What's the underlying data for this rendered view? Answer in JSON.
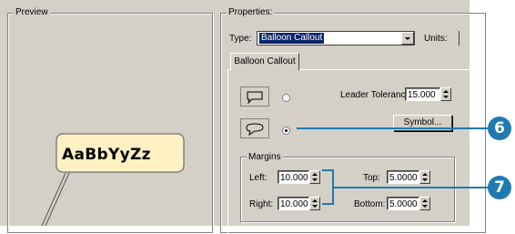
{
  "preview": {
    "title": "Preview",
    "sample_text": "AaBbYyZz"
  },
  "properties": {
    "title": "Properties:",
    "type_label": "Type:",
    "type_value": "Balloon Callout",
    "units_label": "Units:",
    "tab_label": "Balloon Callout",
    "leader_tolerance_label": "Leader Tolerance:",
    "leader_tolerance_value": "15.000",
    "symbol_button": "Symbol...",
    "margins": {
      "title": "Margins",
      "left_label": "Left:",
      "left_value": "10.000",
      "right_label": "Right:",
      "right_value": "10.000",
      "top_label": "Top:",
      "top_value": "5.0000",
      "bottom_label": "Bottom:",
      "bottom_value": "5.0000"
    }
  },
  "annotations": {
    "callout_6": "6",
    "callout_7": "7",
    "color": "#1f7ab0"
  },
  "icons": [
    "rectangle-balloon-icon",
    "rounded-balloon-icon",
    "dropdown-arrow-icon",
    "spin-arrows-icon"
  ]
}
